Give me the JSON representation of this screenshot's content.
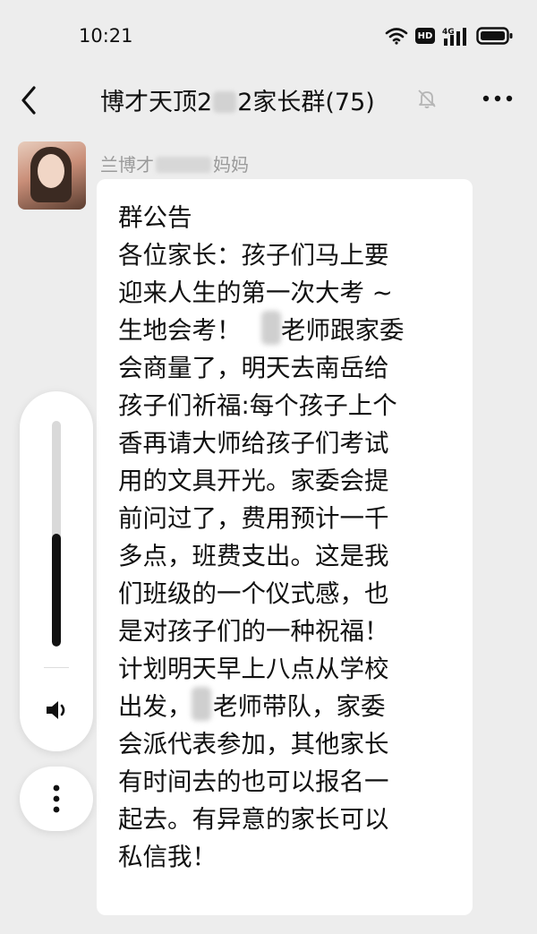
{
  "status_bar": {
    "time": "10:21",
    "icons": [
      "wifi-icon",
      "hd-badge",
      "signal-4g-icon",
      "battery-icon"
    ],
    "hd_label": "HD",
    "network_label": "4G"
  },
  "nav": {
    "title_prefix": "博才天顶2",
    "title_suffix": "2家长群(75)",
    "icons": [
      "back-chevron-icon",
      "mute-bell-icon",
      "more-dots-icon"
    ]
  },
  "message": {
    "sender_prefix": "兰博才",
    "sender_suffix": "妈妈",
    "lines": [
      "群公告",
      "各位家长：孩子们马上要",
      "迎来人生的第一次大考 ~",
      "生地会考！",
      "老师跟家委",
      "会商量了，明天去南岳给",
      "孩子们祈福:每个孩子上个",
      "香再请大师给孩子们考试",
      "用的文具开光。家委会提",
      "前问过了，费用预计一千",
      "多点，班费支出。这是我",
      "们班级的一个仪式感，也",
      "是对孩子们的一种祝福！",
      "计划明天早上八点从学校",
      "出发，",
      "老师带队，家委",
      "会派代表参加，其他家长",
      "有时间去的也可以报名一",
      "起去。有异意的家长可以",
      "私信我！"
    ]
  },
  "volume_overlay": {
    "level": 0.5,
    "icons": [
      "speaker-icon",
      "more-vertical-icon"
    ]
  },
  "colors": {
    "background": "#ededed",
    "bubble": "#ffffff",
    "text": "#111111",
    "muted": "#9a9a9a"
  }
}
